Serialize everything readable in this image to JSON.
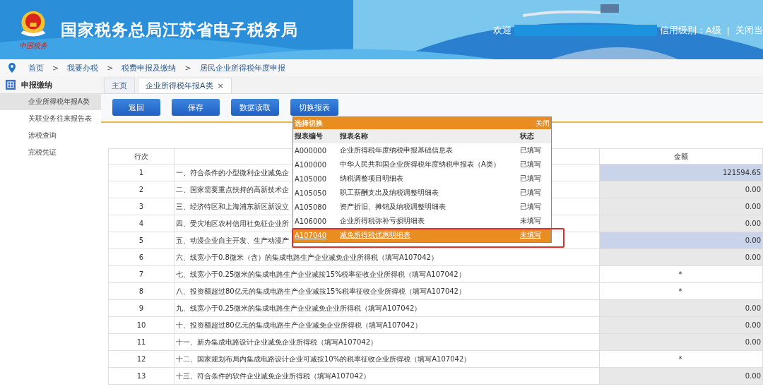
{
  "header": {
    "title": "国家税务总局江苏省电子税务局",
    "logo_caption": "中国税务",
    "welcome": "欢迎",
    "credit": "信用级别：A级",
    "separator": "|",
    "close_link": "关闭当"
  },
  "breadcrumb": [
    "首页",
    ">",
    "我要办税",
    ">",
    "税费申报及缴纳",
    ">",
    "居民企业所得税年度申报"
  ],
  "sidebar": {
    "title": "申报缴纳",
    "items": [
      {
        "label": "企业所得税年报A类",
        "selected": true
      },
      {
        "label": "关联业务往来报告表",
        "selected": false
      },
      {
        "label": "涉税查询",
        "selected": false
      },
      {
        "label": "完税凭证",
        "selected": false
      }
    ]
  },
  "tabs": [
    {
      "label": "主页",
      "selected": false
    },
    {
      "label": "企业所得税年报A类",
      "selected": true,
      "close": "×"
    }
  ],
  "buttons": [
    "返回",
    "保存",
    "数据读取",
    "切换报表"
  ],
  "table": {
    "columns": [
      "行次",
      "金额"
    ],
    "rows": [
      {
        "no": "1",
        "item": "一、符合条件的小型微利企业减免企",
        "amount": "121594.65",
        "kind": "highlighted"
      },
      {
        "no": "2",
        "item": "二、国家需要重点扶持的高新技术企",
        "amount": "0.00",
        "kind": "computed"
      },
      {
        "no": "3",
        "item": "三、经济特区和上海浦东新区新设立",
        "amount": "0.00",
        "kind": "computed"
      },
      {
        "no": "4",
        "item": "四、受灾地区农村信用社免征企业所",
        "amount": "0.00",
        "kind": "computed"
      },
      {
        "no": "5",
        "item": "五、动漫企业自主开发、生产动漫产",
        "amount": "0.00",
        "kind": "highlighted"
      },
      {
        "no": "6",
        "item": "六、线宽小于0.8微米（含）的集成电路生产企业减免企业所得税（填写A107042）",
        "amount": "0.00",
        "kind": "computed"
      },
      {
        "no": "7",
        "item": "七、线宽小于0.25微米的集成电路生产企业减按15%税率征收企业所得税（填写A107042）",
        "amount": "*",
        "kind": "blank"
      },
      {
        "no": "8",
        "item": "八、投资额超过80亿元的集成电路生产企业减按15%税率征收企业所得税（填写A107042）",
        "amount": "*",
        "kind": "blank"
      },
      {
        "no": "9",
        "item": "九、线宽小于0.25微米的集成电路生产企业减免企业所得税（填写A107042）",
        "amount": "0.00",
        "kind": "computed"
      },
      {
        "no": "10",
        "item": "十、投资额超过80亿元的集成电路生产企业减免企业所得税（填写A107042）",
        "amount": "0.00",
        "kind": "computed"
      },
      {
        "no": "11",
        "item": "十一、新办集成电路设计企业减免企业所得税（填写A107042）",
        "amount": "0.00",
        "kind": "computed"
      },
      {
        "no": "12",
        "item": "十二、国家规划布局内集成电路设计企业可减按10%的税率征收企业所得税（填写A107042）",
        "amount": "*",
        "kind": "blank"
      },
      {
        "no": "13",
        "item": "十三、符合条件的软件企业减免企业所得税（填写A107042）",
        "amount": "0.00",
        "kind": "computed"
      }
    ]
  },
  "popup": {
    "title": "选择切换",
    "close": "关闭",
    "columns": [
      "报表编号",
      "报表名称",
      "状态"
    ],
    "rows": [
      {
        "code": "A000000",
        "name": "企业所得税年度纳税申报基础信息表",
        "status": "已填写",
        "selected": false
      },
      {
        "code": "A100000",
        "name": "中华人民共和国企业所得税年度纳税申报表（A类）",
        "status": "已填写",
        "selected": false
      },
      {
        "code": "A105000",
        "name": "纳税调整项目明细表",
        "status": "已填写",
        "selected": false
      },
      {
        "code": "A105050",
        "name": "职工薪酬支出及纳税调整明细表",
        "status": "已填写",
        "selected": false
      },
      {
        "code": "A105080",
        "name": "资产折旧、摊销及纳税调整明细表",
        "status": "已填写",
        "selected": false
      },
      {
        "code": "A106000",
        "name": "企业所得税弥补亏损明细表",
        "status": "未填写",
        "selected": false
      },
      {
        "code": "A107040",
        "name": "减免所得税优惠明细表",
        "status": "未填写",
        "selected": true
      }
    ]
  }
}
